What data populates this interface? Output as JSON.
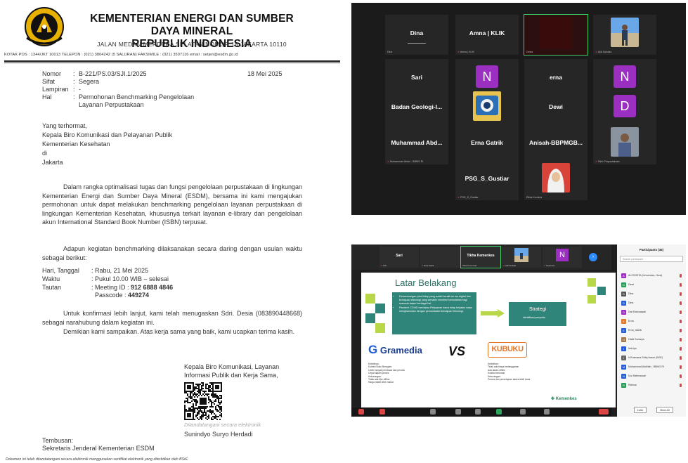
{
  "letter": {
    "kop_title_1": "KEMENTERIAN ENERGI DAN SUMBER DAYA MINERAL",
    "kop_title_2": "REPUBLIK INDONESIA",
    "kop_address": "JALAN MEDAN MERDEKA SELATAN NOMOR 18 JAKARTA 10110",
    "kop_contacts": "KOTAK POS : 1344/JKT 10013  TELEPON : (021) 3804242 (5 SALURAN)  FAKSIMILE : (021) 3507116  email : setjen@esdm.go.id",
    "meta": [
      {
        "k": "Nomor",
        "v": "B-221/PS.03/SJI.1/2025"
      },
      {
        "k": "Sifat",
        "v": "Segera"
      },
      {
        "k": "Lampiran",
        "v": "-"
      },
      {
        "k": "Hal",
        "v": "Permohonan Benchmarking Pengelolaan"
      },
      {
        "k": "",
        "v": "Layanan Perpustakaan"
      }
    ],
    "date": "18 Mei 2025",
    "addressee": [
      "Yang terhormat,",
      "Kepala Biro Komunikasi dan Pelayanan Publik",
      "Kementerian Kesehatan",
      "di",
      "Jakarta"
    ],
    "paragraph_1": "Dalam rangka optimalisasi tugas dan fungsi pengelolaan perpustakaan di lingkungan Kementerian Energi dan Sumber Daya Mineral (ESDM), bersama ini kami mengajukan permohonan untuk dapat melakukan benchmarking pengelolaan layanan perpustakaan di lingkungan Kementerian Kesehatan, khususnya terkait layanan e-library dan pengelolaan akun International Standard Book Number (ISBN) terpusat.",
    "paragraph_2": "Adapun kegiatan benchmarking dilaksanakan secara daring dengan usulan waktu sebagai berikut:",
    "details": [
      {
        "k": "Hari, Tanggal",
        "v": ": Rabu, 21 Mei 2025",
        "b": ""
      },
      {
        "k": "Waktu",
        "v": ": Pukul 10.00 WIB – selesai",
        "b": ""
      },
      {
        "k": "Tautan",
        "v": ": Meeting ID : ",
        "b": "912 6888 4846"
      },
      {
        "k": "",
        "v": "  Passcode : ",
        "b": "449274"
      }
    ],
    "paragraph_3": "Untuk konfirmasi lebih lanjut, kami telah menugaskan Sdri. Desia (083890448668) sebagai narahubung dalam kegiatan ini.",
    "paragraph_4": "Demikian kami sampaikan. Atas kerja sama yang baik, kami ucapkan terima kasih.",
    "sign_title_1": "Kepala Biro Komunikasi, Layanan",
    "sign_title_2": "Informasi Publik dan Kerja Sama,",
    "sign_note": "Ditandatangani secara elektronik",
    "sign_name": "Sunindyo Suryo Herdadi",
    "cc_label": "Tembusan:",
    "cc_value": "Sekretaris Jenderal Kementerian ESDM",
    "footer_note": "Dokumen ini telah ditandatangani secara elektronik menggunakan sertifikat elektronik yang diterbitkan oleh BSrE"
  },
  "video_grid": {
    "tiles": [
      {
        "name": "Dina",
        "sub": "Dina",
        "type": "name"
      },
      {
        "name": "Amna | KLIK",
        "sub": "Amna | KLIK",
        "type": "name"
      },
      {
        "name": "",
        "sub": "Desia",
        "type": "dark"
      },
      {
        "name": "",
        "sub": "Aldi Suhada",
        "type": "photo-beach"
      },
      {
        "name": "Sari",
        "sub": "Sari",
        "type": "name"
      },
      {
        "name": "",
        "sub": "Nurul Aini",
        "type": "avatar",
        "letter": "N",
        "color": "#9b2fc2"
      },
      {
        "name": "erna",
        "sub": "erna",
        "type": "name"
      },
      {
        "name": "",
        "sub": "NURUL Perpustakaan",
        "type": "avatar",
        "letter": "N",
        "color": "#9b2fc2"
      },
      {
        "name": "Badan Geologi-I...",
        "sub": "Badan Geologi-Perpustakaan",
        "type": "name"
      },
      {
        "name": "",
        "sub": "Perpustakaan Pusat",
        "type": "photo-blue"
      },
      {
        "name": "Dewi",
        "sub": "Dewi",
        "type": "name"
      },
      {
        "name": "",
        "sub": "Desia Kemkes",
        "type": "avatar",
        "letter": "D",
        "color": "#9b2fc2"
      },
      {
        "name": "Muhammad Abd...",
        "sub": "Muhammad Abdul - BBMG RI",
        "type": "name"
      },
      {
        "name": "Erna Gatrik",
        "sub": "Erna Gatrik",
        "type": "name"
      },
      {
        "name": "Anisah-BBPMGB...",
        "sub": "Anisah-BBPMGB LEMIGAS",
        "type": "name"
      },
      {
        "name": "",
        "sub": "Ririn Perpustakaan",
        "type": "photo-man"
      },
      {
        "name": "PSG_S_Gustiar",
        "sub": "PSG_S_Gustiar",
        "type": "name"
      },
      {
        "name": "",
        "sub": "Rinta Kemkes",
        "type": "photo-hijab"
      }
    ]
  },
  "zoom": {
    "strip": [
      {
        "name": "Sari",
        "sub": "Sari"
      },
      {
        "name": "",
        "sub": "Erna Gatrik"
      },
      {
        "name": "Tikha Kemenkes",
        "sub": "Tikha Kemenkes"
      },
      {
        "name": "",
        "sub": "Aldi Suhada"
      },
      {
        "name": "",
        "sub": "Nurul Aini"
      }
    ],
    "slide": {
      "title": "Latar Belakang",
      "bullets": [
        "Perkembangan pola hidup yang sudah beralih ke era digital dan kemajuan teknologi yang semakin memberi kemudahan bagi manusia dalam berbagai hal.",
        "Pandemi COVID memaksa Pelayanan harus tetap berjalan maka mengharuskan dengan pemanfaatan kemajuan teknologi."
      ],
      "strategy_title": "Strategi",
      "strategy_sub": "Identifikasi penyedia",
      "gramedia": "Gramedia",
      "vs": "VS",
      "kbuku": "KUBUKU",
      "kemkes": "Kemenkes",
      "gramedia_list": [
        "Kelebihan:",
        "Koleksi Buku Beragam",
        "Lebih banyak pembaca dan penulis",
        "Cepat dalam proses",
        "Kekurangan:",
        "Tidak ada fitur offline",
        "Harga relatif lebih mahal"
      ],
      "kbuku_list": [
        "Kelebihan:",
        "Tidak ada biaya berlangganan",
        "Ada akses offline",
        "Koleksi terkurasi",
        "Kekurangan:",
        "Proses dan persetujuan akses lebih lama"
      ]
    },
    "panel": {
      "title": "Participants (35)",
      "search_placeholder": "Search participant",
      "participants": [
        {
          "name": "Ari ROSITA (Kemenkes, Host)",
          "letter": "A",
          "color": "#9b2fc2"
        },
        {
          "name": "Dewi",
          "letter": "D",
          "color": "#2a9d5b"
        },
        {
          "name": "Dina",
          "letter": "D",
          "color": "#555555"
        },
        {
          "name": "Dina",
          "letter": "D",
          "color": "#2a5bd6"
        },
        {
          "name": "Dwi Rahmawati",
          "letter": "D",
          "color": "#9b2fc2"
        },
        {
          "name": "Erna",
          "letter": "E",
          "color": "#e47628"
        },
        {
          "name": "Erna_Gatrik",
          "letter": "E",
          "color": "#2a5bd6"
        },
        {
          "name": "Hafiz Sunarya",
          "letter": "H",
          "color": "#a0784a"
        },
        {
          "name": "Ida Ayu",
          "letter": "I",
          "color": "#2a5bd6"
        },
        {
          "name": "Ir.Rusmana Sidiq Harun (BGE)",
          "letter": "I",
          "color": "#666666"
        },
        {
          "name": "Muhammad Abdillah - BBMG RI",
          "letter": "M",
          "color": "#2a5bd6"
        },
        {
          "name": "Nur Rahmawati",
          "letter": "N",
          "color": "#2a5bd6"
        },
        {
          "name": "Rahma",
          "letter": "R",
          "color": "#2a9d5b"
        }
      ],
      "invite_label": "Invite",
      "mute_label": "Mute All"
    }
  }
}
